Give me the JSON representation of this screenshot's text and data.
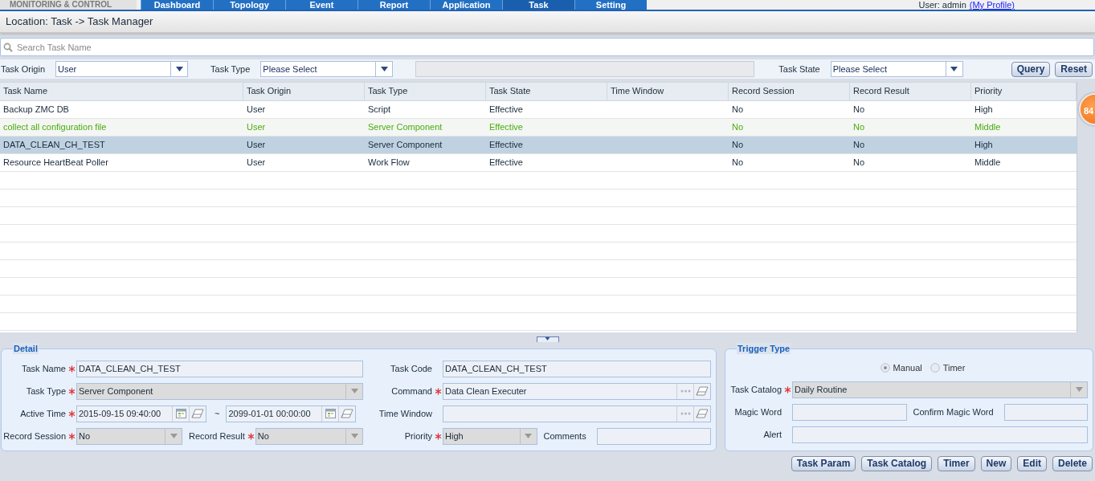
{
  "header": {
    "app_name": "MONITORING & CONTROL",
    "tabs": [
      {
        "label": "Dashboard",
        "selected": false
      },
      {
        "label": "Topology",
        "selected": false
      },
      {
        "label": "Event",
        "selected": false
      },
      {
        "label": "Report",
        "selected": false
      },
      {
        "label": "Application",
        "selected": false
      },
      {
        "label": "Task",
        "selected": true
      },
      {
        "label": "Setting",
        "selected": false
      }
    ],
    "user": "User: admin",
    "profile_link": "(My Profile)"
  },
  "location": "Location: Task -> Task Manager",
  "search": {
    "placeholder": "Search Task Name"
  },
  "filters": [
    {
      "kind": "select",
      "label": "Task Origin",
      "value": "User"
    },
    {
      "kind": "select",
      "label": "Task Type",
      "value": "Please Select"
    },
    {
      "kind": "text"
    },
    {
      "kind": "select",
      "label": "Task State",
      "value": "Please Select"
    }
  ],
  "filter_buttons": [
    "Query",
    "Reset"
  ],
  "table": {
    "columns": [
      "Task Name",
      "Task Origin",
      "Task Type",
      "Task State",
      "Time Window",
      "Record Session",
      "Record Result",
      "Priority"
    ],
    "rows": [
      {
        "cells": [
          "Backup ZMC DB",
          "User",
          "Script",
          "Effective",
          "",
          "No",
          "No",
          "High"
        ],
        "hovered": false,
        "selected": false
      },
      {
        "cells": [
          "collect all configuration file",
          "User",
          "Server Component",
          "Effective",
          "",
          "No",
          "No",
          "Middle"
        ],
        "hovered": true,
        "selected": false
      },
      {
        "cells": [
          "DATA_CLEAN_CH_TEST",
          "User",
          "Server Component",
          "Effective",
          "",
          "No",
          "No",
          "High"
        ],
        "hovered": false,
        "selected": true
      },
      {
        "cells": [
          "Resource HeartBeat Poller",
          "User",
          "Work Flow",
          "Effective",
          "",
          "No",
          "No",
          "Middle"
        ],
        "hovered": false,
        "selected": false
      }
    ]
  },
  "badge": "84",
  "detail": {
    "title": "Detail",
    "rows": [
      {
        "left": [
          {
            "kind": "text",
            "label": "Task Name",
            "required": true,
            "value": "DATA_CLEAN_CH_TEST"
          }
        ],
        "right": [
          {
            "kind": "text",
            "label": "Task Code",
            "required": false,
            "value": "DATA_CLEAN_CH_TEST"
          }
        ]
      },
      {
        "left": [
          {
            "kind": "select",
            "label": "Task Type",
            "required": true,
            "value": "Server Component"
          }
        ],
        "right": [
          {
            "kind": "picker",
            "label": "Command",
            "required": true,
            "value": "Data Clean Executer"
          }
        ]
      },
      {
        "left": [
          {
            "kind": "date",
            "label": "Active Time",
            "required": true,
            "value": "2015-09-15 09:40:00"
          },
          {
            "kind": "separator",
            "text": "~"
          },
          {
            "kind": "date",
            "value": "2099-01-01 00:00:00"
          }
        ],
        "right": [
          {
            "kind": "picker",
            "label": "Time Window",
            "required": false
          }
        ]
      },
      {
        "left": [
          {
            "kind": "select",
            "label": "Record Session",
            "required": true,
            "value": "No"
          },
          {
            "kind": "select",
            "label": "Record Result",
            "required": true,
            "value": "No"
          }
        ],
        "right": [
          {
            "kind": "select",
            "label": "Priority",
            "required": true,
            "value": "High"
          },
          {
            "kind": "text",
            "label": "Comments",
            "required": false
          }
        ]
      }
    ]
  },
  "trigger": {
    "title": "Trigger Type",
    "radios": [
      {
        "label": "Manual",
        "selected": true
      },
      {
        "label": "Timer",
        "selected": false
      }
    ],
    "rows": [
      [
        {
          "kind": "select",
          "label": "Task Catalog",
          "required": true,
          "value": "Daily Routine"
        }
      ],
      [
        {
          "kind": "text",
          "label": "Magic Word",
          "required": false
        },
        {
          "kind": "text",
          "label": "Confirm Magic Word",
          "required": false
        }
      ],
      [
        {
          "kind": "text",
          "label": "Alert",
          "required": false
        }
      ]
    ]
  },
  "buttons": [
    "Task Param",
    "Task Catalog",
    "Timer",
    "New",
    "Edit",
    "Delete"
  ]
}
